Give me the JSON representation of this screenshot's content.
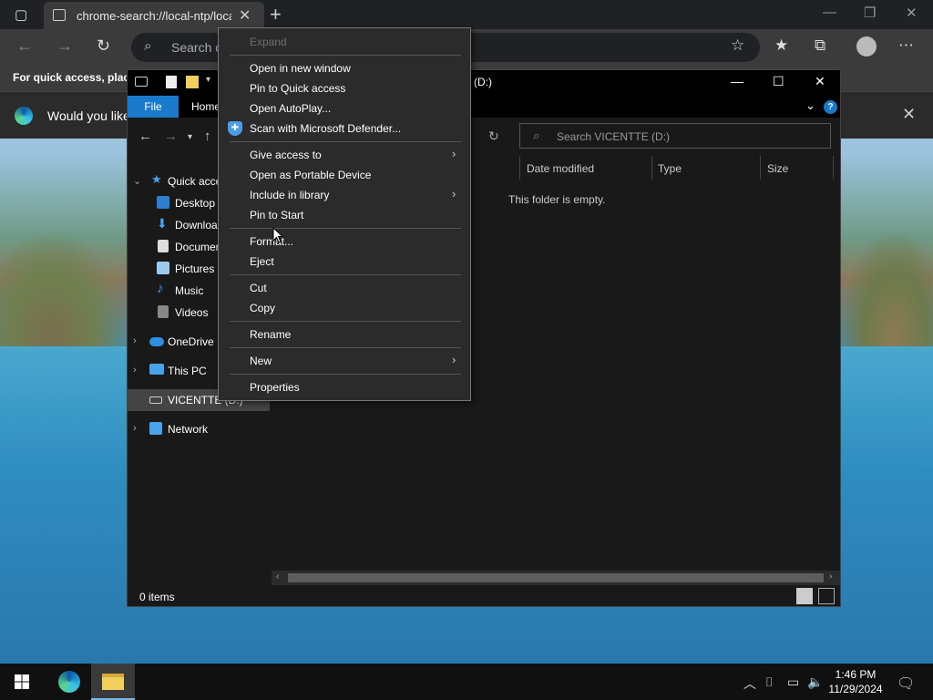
{
  "browser": {
    "tab_title": "chrome-search://local-ntp/local-ntp.html",
    "new_tab_icon": "plus-icon",
    "address_placeholder": "Search or enter web address",
    "favorites_bar_text": "For quick access, place your favorites here on the favorites bar.",
    "infobar_message": "Would you like to make Microsoft Edge your default browser?"
  },
  "explorer": {
    "title": "(D:)",
    "ribbon_tabs": [
      "File",
      "Home"
    ],
    "help_label": "?",
    "search_placeholder": "Search VICENTTE (D:)",
    "nav_items": [
      {
        "label": "Quick access",
        "icon": "star-icon"
      },
      {
        "label": "Desktop",
        "icon": "desktop-icon"
      },
      {
        "label": "Downloads",
        "icon": "download-icon"
      },
      {
        "label": "Documents",
        "icon": "document-icon"
      },
      {
        "label": "Pictures",
        "icon": "pictures-icon"
      },
      {
        "label": "Music",
        "icon": "music-icon"
      },
      {
        "label": "Videos",
        "icon": "videos-icon"
      },
      {
        "label": "OneDrive",
        "icon": "cloud-icon"
      },
      {
        "label": "This PC",
        "icon": "pc-icon"
      },
      {
        "label": "VICENTTE (D:)",
        "icon": "drive-icon"
      },
      {
        "label": "Network",
        "icon": "network-icon"
      }
    ],
    "columns": [
      "Date modified",
      "Type",
      "Size"
    ],
    "empty_message": "This folder is empty.",
    "status_items": "0 items"
  },
  "context_menu": {
    "items": [
      {
        "label": "Expand",
        "disabled": true
      },
      {
        "label": "Open in new window"
      },
      {
        "label": "Pin to Quick access"
      },
      {
        "label": "Open AutoPlay..."
      },
      {
        "label": "Scan with Microsoft Defender..."
      },
      {
        "label": "Give access to",
        "submenu": true
      },
      {
        "label": "Open as Portable Device"
      },
      {
        "label": "Include in library",
        "submenu": true
      },
      {
        "label": "Pin to Start"
      },
      {
        "label": "Format..."
      },
      {
        "label": "Eject"
      },
      {
        "label": "Cut"
      },
      {
        "label": "Copy"
      },
      {
        "label": "Rename"
      },
      {
        "label": "New",
        "submenu": true
      },
      {
        "label": "Properties"
      }
    ]
  },
  "taskbar": {
    "time": "1:46 PM",
    "date": "11/29/2024"
  },
  "colors": {
    "accent": "#1979ca",
    "menu_bg": "#2b2b2b",
    "explorer_bg": "#191919"
  }
}
